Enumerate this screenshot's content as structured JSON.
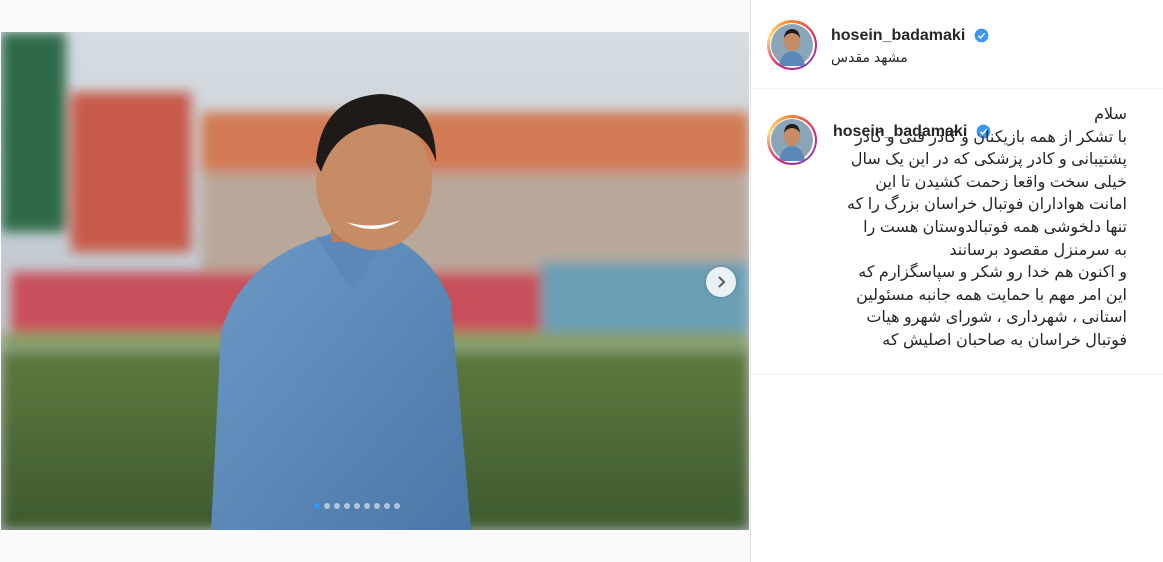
{
  "post": {
    "username": "hosein_badamaki",
    "location": "مشهد مقدس",
    "verified": true,
    "carousel": {
      "total": 9,
      "active": 0
    }
  },
  "caption": {
    "username": "hosein_badamaki",
    "lines": [
      "سلام",
      "با تشکر از همه بازیکنان و کادر فنی و کادر",
      "پشتیبانی و کادر پزشکی که در این یک سال",
      "خیلی سخت واقعا زحمت کشیدن تا این",
      "امانت هواداران فوتبال خراسان بزرگ را که",
      "تنها دلخوشی همه فوتبالدوستان هست را",
      "به سرمنزل مقصود برسانند",
      "و اکنون هم خدا رو شکر و سپاسگزارم که",
      "این امر مهم با حمایت همه جانبه مسئولین",
      "استانی ، شهرداری ، شورای شهرو هیات",
      "فوتبال خراسان به صاحبان اصلیش که"
    ]
  },
  "icons": {
    "next": "chevron-right-icon",
    "verified": "verified-badge-icon"
  },
  "colors": {
    "accent": "#3897f0",
    "text": "#262626",
    "border": "#efefef"
  }
}
